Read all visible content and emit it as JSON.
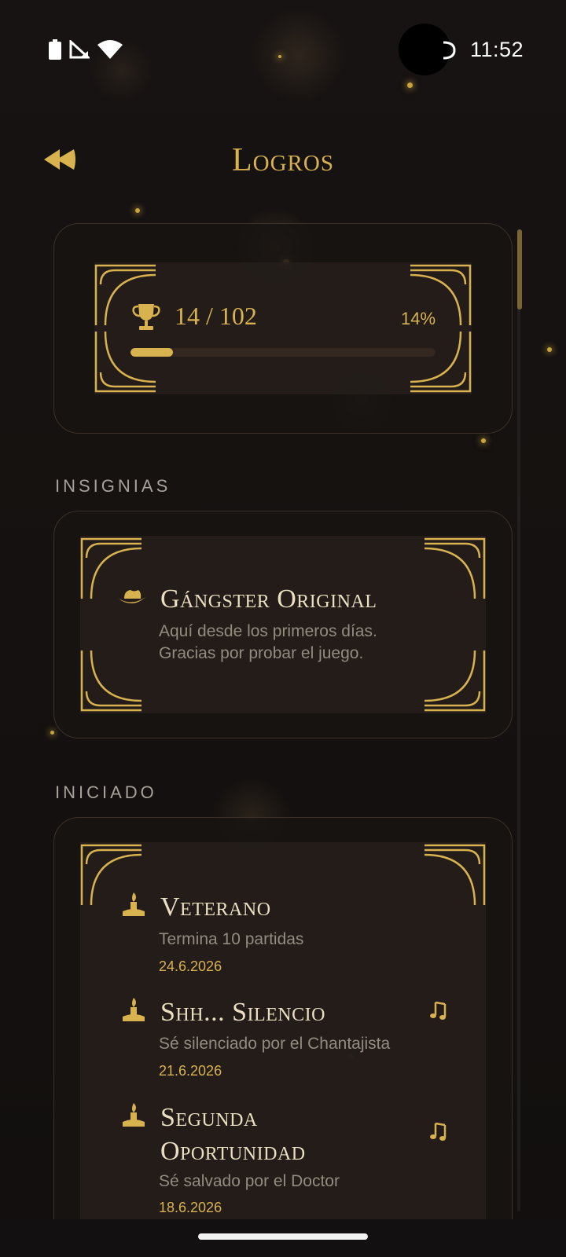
{
  "status_bar": {
    "time": "11:52"
  },
  "header": {
    "title": "Logros",
    "back_icon": "double-chevron-left-icon"
  },
  "progress": {
    "count_label": "14 / 102",
    "percent_label": "14%",
    "fraction": 0.14,
    "icon": "trophy-icon"
  },
  "sections": {
    "insignias": {
      "label": "INSIGNIAS",
      "badge": {
        "icon": "fedora-hat-icon",
        "title": "Gángster Original",
        "description_line1": "Aquí desde los primeros días.",
        "description_line2": "Gracias por probar el juego."
      }
    },
    "iniciado": {
      "label": "INICIADO",
      "items": [
        {
          "icon": "candle-icon",
          "title": "Veterano",
          "description": "Termina 10 partidas",
          "date": "24.6.2026",
          "has_note": false
        },
        {
          "icon": "candle-icon",
          "title": "Shh... Silencio",
          "description": "Sé silenciado por el Chantajista",
          "date": "21.6.2026",
          "has_note": true
        },
        {
          "icon": "candle-icon",
          "title_line1": "Segunda",
          "title_line2": "Oportunidad",
          "description": "Sé salvado por el Doctor",
          "date": "18.6.2026",
          "has_note": true
        }
      ]
    }
  },
  "colors": {
    "accent": "#d8b24e",
    "background": "#141110",
    "card_border": "#3a3129"
  }
}
